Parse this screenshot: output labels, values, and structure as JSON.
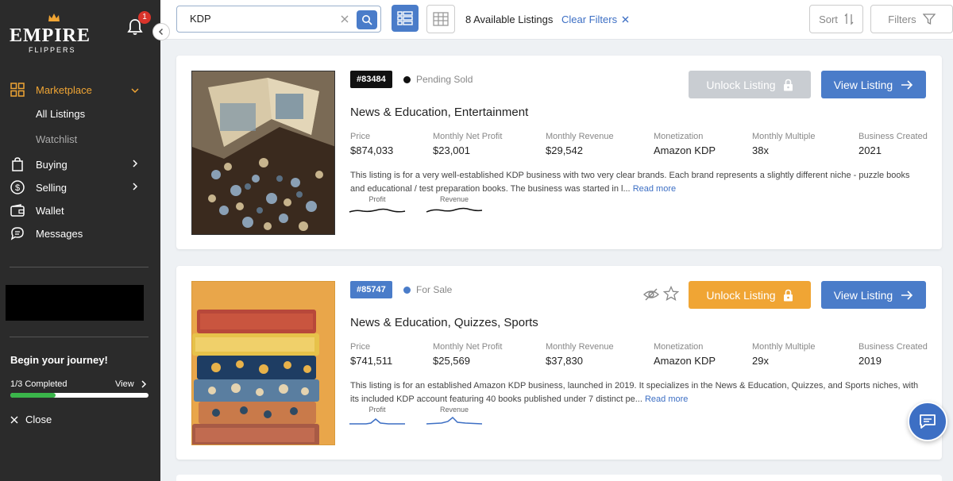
{
  "brand": {
    "name": "EMPIRE",
    "sub": "FLIPPERS",
    "accent": "#f0a534"
  },
  "notifications": {
    "count": "1"
  },
  "sidebar": {
    "marketplace": "Marketplace",
    "all_listings": "All Listings",
    "watchlist": "Watchlist",
    "buying": "Buying",
    "selling": "Selling",
    "wallet": "Wallet",
    "messages": "Messages",
    "journey_title": "Begin your journey!",
    "journey_progress": "1/3 Completed",
    "journey_progress_fraction": 0.33,
    "journey_view": "View",
    "close": "Close"
  },
  "topbar": {
    "search_value": "KDP",
    "listings_count": "8 Available Listings",
    "clear_filters": "Clear Filters",
    "sort": "Sort",
    "filters": "Filters"
  },
  "listings": [
    {
      "id": "#83484",
      "status": "Pending Sold",
      "status_color": "#111111",
      "badge_color": "#111111",
      "title": "News & Education, Entertainment",
      "price_label": "Price",
      "price": "$874,033",
      "profit_label": "Monthly Net Profit",
      "profit": "$23,001",
      "revenue_label": "Monthly Revenue",
      "revenue": "$29,542",
      "monetization_label": "Monetization",
      "monetization": "Amazon KDP",
      "multiple_label": "Monthly Multiple",
      "multiple": "38x",
      "created_label": "Business Created",
      "created": "2021",
      "description": "This listing is for a very well-established KDP business with two very clear brands. Each brand represents a slightly different niche - puzzle books and educational / test preparation books. The business was started in l...",
      "read_more": "Read more",
      "spark_profit": "Profit",
      "spark_revenue": "Revenue",
      "unlock": "Unlock Listing",
      "unlock_color": "#c9cdd2",
      "view": "View Listing"
    },
    {
      "id": "#85747",
      "status": "For Sale",
      "status_color": "#4a7cc9",
      "badge_color": "#4a7cc9",
      "title": "News & Education, Quizzes, Sports",
      "price_label": "Price",
      "price": "$741,511",
      "profit_label": "Monthly Net Profit",
      "profit": "$25,569",
      "revenue_label": "Monthly Revenue",
      "revenue": "$37,830",
      "monetization_label": "Monetization",
      "monetization": "Amazon KDP",
      "multiple_label": "Monthly Multiple",
      "multiple": "29x",
      "created_label": "Business Created",
      "created": "2019",
      "description": "This listing is for an established Amazon KDP business, launched in 2019. It specializes in the News & Education, Quizzes, and Sports niches, with its included KDP account featuring 40 books published under 7 distinct pe...",
      "read_more": "Read more",
      "spark_profit": "Profit",
      "spark_revenue": "Revenue",
      "unlock": "Unlock Listing",
      "unlock_color": "#f0a534",
      "view": "View Listing"
    }
  ]
}
